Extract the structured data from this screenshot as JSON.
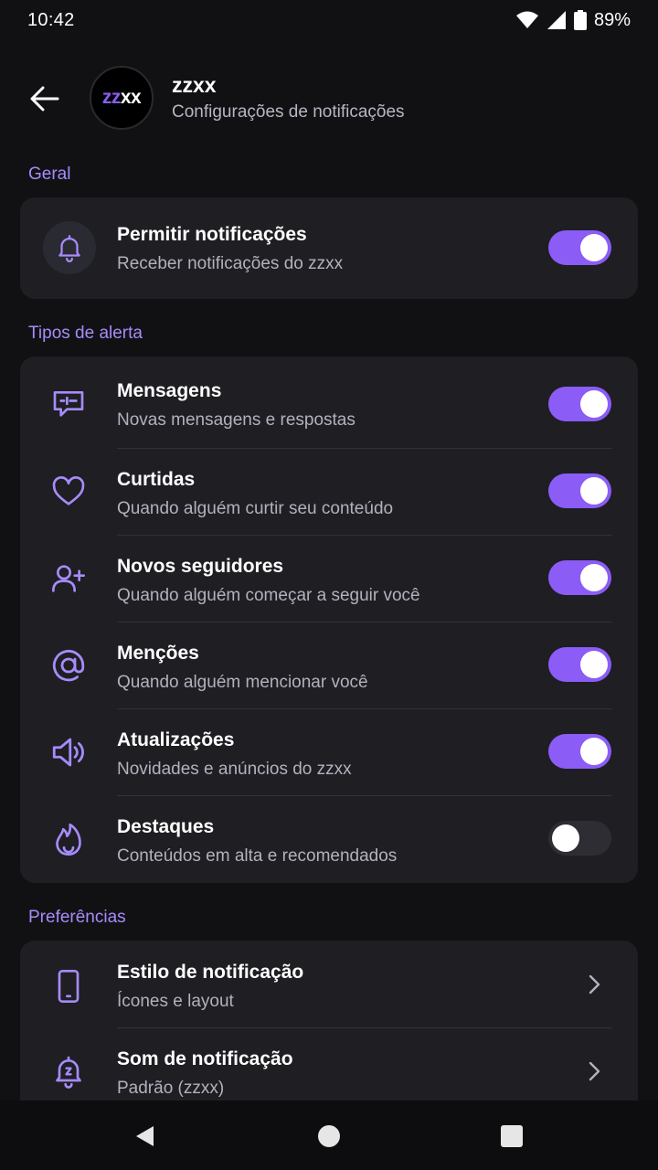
{
  "status": {
    "time": "10:42",
    "battery": "89%"
  },
  "header": {
    "avatar_text_1": "zz",
    "avatar_text_2": "xx",
    "title": "zzxx",
    "subtitle": "Configurações de notificações"
  },
  "sections": {
    "general": {
      "label": "Geral",
      "items": [
        {
          "title": "Permitir notificações",
          "subtitle": "Receber notificações do zzxx",
          "icon": "bell-icon",
          "enabled": true
        }
      ]
    },
    "alerts": {
      "label": "Tipos de alerta",
      "items": [
        {
          "title": "Mensagens",
          "subtitle": "Novas mensagens e respostas",
          "icon": "message-icon",
          "enabled": true
        },
        {
          "title": "Curtidas",
          "subtitle": "Quando alguém curtir seu conteúdo",
          "icon": "heart-icon",
          "enabled": true
        },
        {
          "title": "Novos seguidores",
          "subtitle": "Quando alguém começar a seguir você",
          "icon": "user-plus-icon",
          "enabled": true
        },
        {
          "title": "Menções",
          "subtitle": "Quando alguém mencionar você",
          "icon": "at-icon",
          "enabled": true
        },
        {
          "title": "Atualizações",
          "subtitle": "Novidades e anúncios do zzxx",
          "icon": "speaker-icon",
          "enabled": true
        },
        {
          "title": "Destaques",
          "subtitle": "Conteúdos em alta e recomendados",
          "icon": "flame-icon",
          "enabled": false
        }
      ]
    },
    "preferences": {
      "label": "Preferências",
      "items": [
        {
          "title": "Estilo de notificação",
          "subtitle": "Ícones e layout",
          "icon": "phone-icon"
        },
        {
          "title": "Som de notificação",
          "subtitle": "Padrão (zzxx)",
          "icon": "bell-z-icon"
        }
      ]
    }
  },
  "colors": {
    "accent": "#8b5cf6",
    "background": "#111114",
    "card": "#1e1e23"
  }
}
